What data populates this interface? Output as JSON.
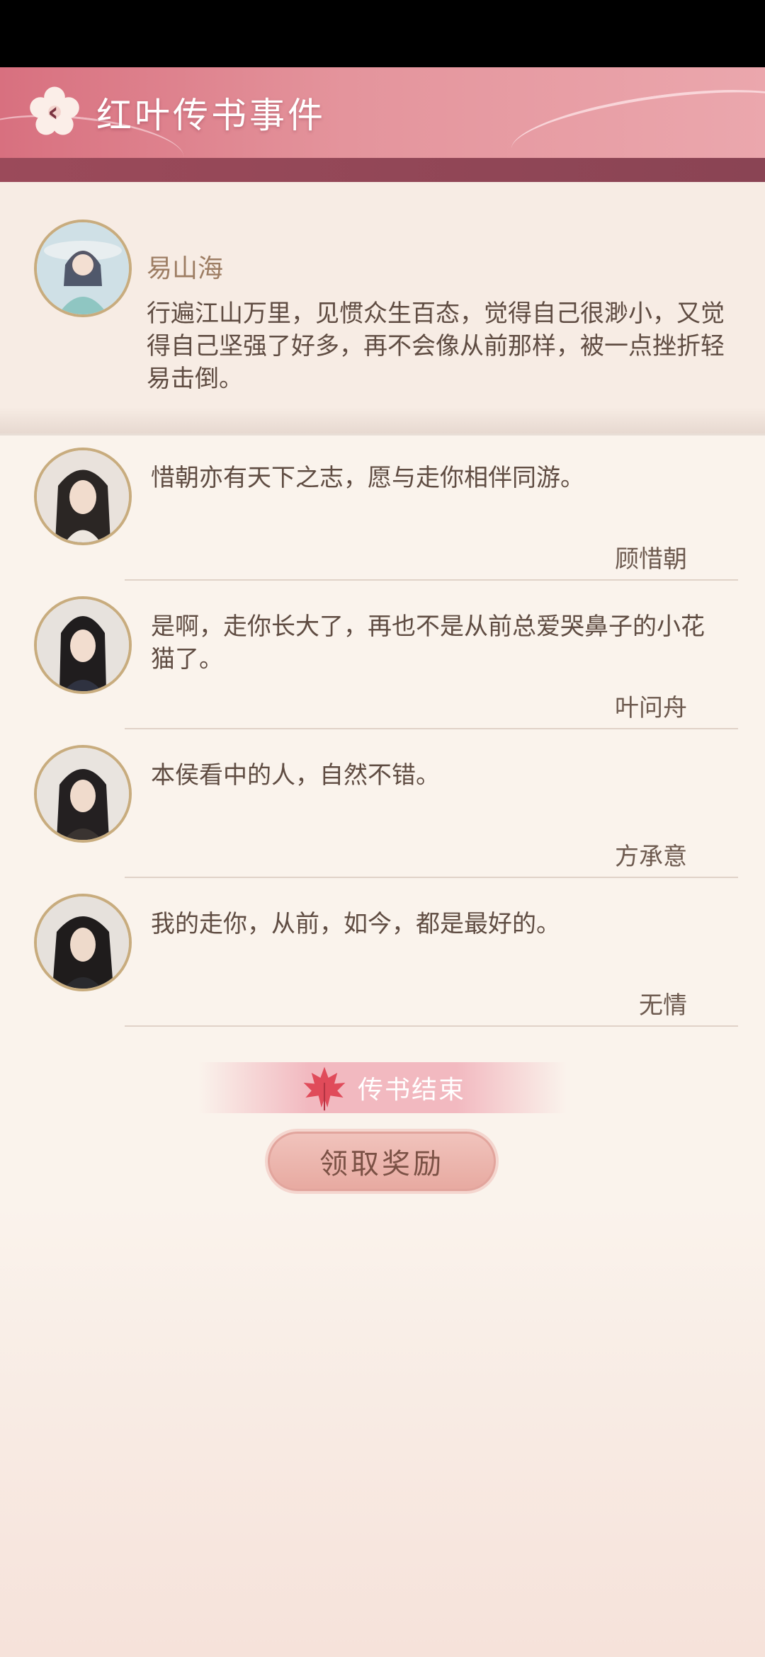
{
  "header": {
    "title": "红叶传书事件"
  },
  "main_letter": {
    "name": "易山海",
    "text": "行遍江山万里，见惯众生百态，觉得自己很渺小，又觉得自己坚强了好多，再不会像从前那样，被一点挫折轻易击倒。"
  },
  "replies": [
    {
      "text": "惜朝亦有天下之志，愿与走你相伴同游。",
      "name": "顾惜朝"
    },
    {
      "text": "是啊，走你长大了，再也不是从前总爱哭鼻子的小花猫了。",
      "name": "叶问舟"
    },
    {
      "text": "本侯看中的人，自然不错。",
      "name": "方承意"
    },
    {
      "text": "我的走你，从前，如今，都是最好的。",
      "name": "无情"
    }
  ],
  "end_banner": {
    "label": "传书结束"
  },
  "claim_button": {
    "label": "领取奖励"
  },
  "icons": {
    "back": "chevron-left-icon",
    "flower": "plum-blossom-icon",
    "leaf": "maple-leaf-icon"
  },
  "colors": {
    "accent": "#d8707f",
    "button": "#eab0a7"
  }
}
